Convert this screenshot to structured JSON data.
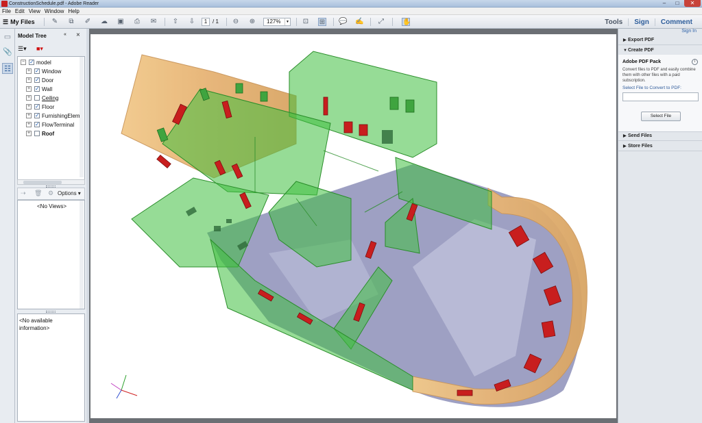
{
  "window": {
    "title": "ConstructionSchedule.pdf - Adobe Reader"
  },
  "menu": [
    "File",
    "Edit",
    "View",
    "Window",
    "Help"
  ],
  "toolbar": {
    "my_files": "My Files",
    "page_current": "1",
    "page_total": "/ 1",
    "zoom": "127%",
    "right_tabs": {
      "tools": "Tools",
      "sign": "Sign",
      "comment": "Comment"
    }
  },
  "model_tree": {
    "title": "Model Tree",
    "items": [
      {
        "label": "model",
        "checked": true,
        "style": "normal"
      },
      {
        "label": "Window",
        "checked": true,
        "style": "normal"
      },
      {
        "label": "Door",
        "checked": true,
        "style": "normal"
      },
      {
        "label": "Wall",
        "checked": true,
        "style": "normal"
      },
      {
        "label": "Ceiling",
        "checked": false,
        "style": "underline"
      },
      {
        "label": "Floor",
        "checked": true,
        "style": "normal"
      },
      {
        "label": "FurnishingElem",
        "checked": true,
        "style": "normal"
      },
      {
        "label": "FlowTerminal",
        "checked": true,
        "style": "normal"
      },
      {
        "label": "Roof",
        "checked": false,
        "style": "bold"
      }
    ],
    "views_options": "Options",
    "no_views": "<No Views>",
    "no_info": "<No available information>"
  },
  "right_pane": {
    "sign_in": "Sign In",
    "export_pdf": "Export PDF",
    "create_pdf": "Create PDF",
    "card_title": "Adobe PDF Pack",
    "card_text": "Convert files to PDF and easily combine them with other files with a paid subscription.",
    "select_label": "Select File to Convert to PDF:",
    "select_button": "Select File",
    "send_files": "Send Files",
    "store_files": "Store Files"
  },
  "colors": {
    "wall_green": "#3fbf3f",
    "exterior_tan": "#e8b878",
    "floor_slate": "#8d8fb8",
    "door_red": "#c81e1e",
    "link_blue": "#2e62a8"
  }
}
